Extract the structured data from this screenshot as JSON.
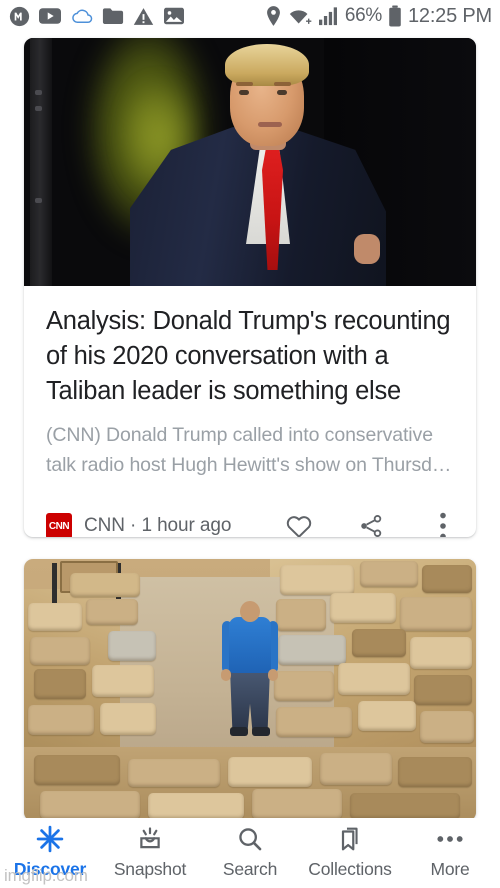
{
  "status_bar": {
    "left_icons": [
      {
        "name": "medium-app-icon",
        "glyph": "M"
      },
      {
        "name": "youtube-icon",
        "glyph": "play"
      },
      {
        "name": "cloud-sync-icon",
        "glyph": "cloud"
      },
      {
        "name": "folder-icon",
        "glyph": "folder"
      },
      {
        "name": "warning-icon",
        "glyph": "warning"
      },
      {
        "name": "screenshot-icon",
        "glyph": "image"
      }
    ],
    "location_icon": "location-pin-icon",
    "wifi_icon": "wifi-icon",
    "signal_icon": "cellular-signal-icon",
    "battery_percent": "66%",
    "battery_icon": "battery-icon",
    "time": "12:25 PM"
  },
  "feed": {
    "cards": [
      {
        "image_alt": "Donald Trump in navy suit and red tie",
        "headline": "Analysis: Donald Trump's recounting of his 2020 conversation with a Taliban leader is something else",
        "snippet": "(CNN) Donald Trump called into conservative talk radio host Hugh Hewitt's show on Thursd…",
        "source_badge": "CNN",
        "source_line": "CNN · 1 hour ago",
        "actions": [
          {
            "name": "like-button",
            "icon": "heart-icon"
          },
          {
            "name": "share-button",
            "icon": "share-icon"
          },
          {
            "name": "more-options-button",
            "icon": "three-dot-menu-icon"
          }
        ]
      },
      {
        "image_alt": "Man in blue shirt standing in archaeological stone ruins"
      }
    ]
  },
  "bottom_nav": {
    "items": [
      {
        "label": "Discover",
        "icon": "asterisk-icon",
        "active": true
      },
      {
        "label": "Snapshot",
        "icon": "snapshot-icon",
        "active": false
      },
      {
        "label": "Search",
        "icon": "search-icon",
        "active": false
      },
      {
        "label": "Collections",
        "icon": "bookmark-stack-icon",
        "active": false
      },
      {
        "label": "More",
        "icon": "three-dot-horizontal-icon",
        "active": false
      }
    ],
    "active_color": "#1a73e8",
    "inactive_color": "#5f6368"
  },
  "watermark": "imgflip.com"
}
